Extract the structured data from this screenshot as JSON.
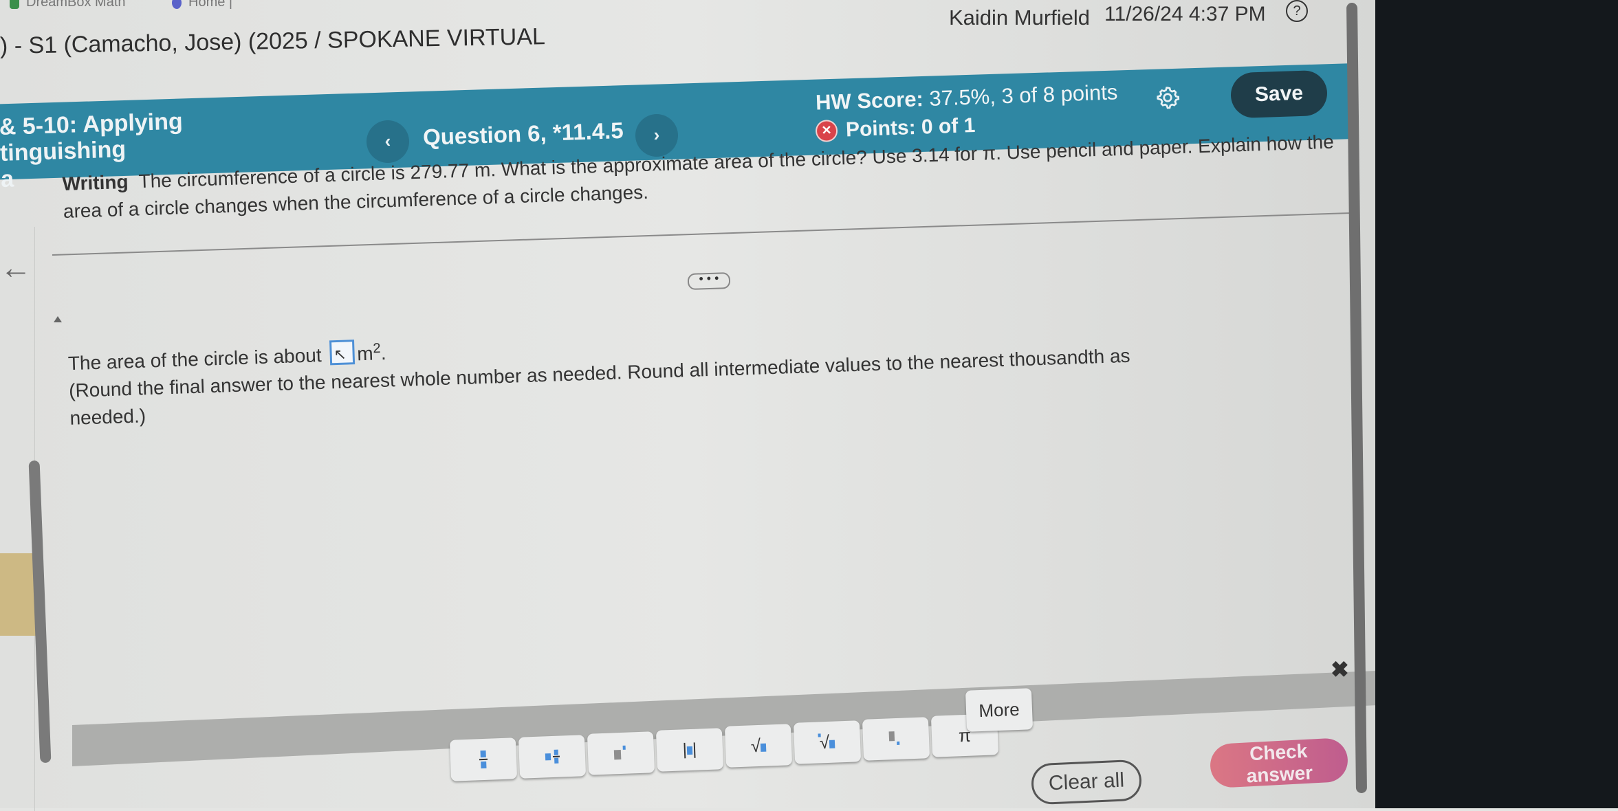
{
  "browser": {
    "bookmarks": [
      {
        "label": "DreamBox Math",
        "icon": "dreambox-icon",
        "color": "#3a8f4a"
      },
      {
        "label": "Home |",
        "icon": "home-bookmark-icon",
        "color": "#5a62c9"
      }
    ]
  },
  "header": {
    "course_title": ") - S1 (Camacho, Jose) (2025 / SPOKANE VIRTUAL",
    "user_name": "Kaidin Murfield",
    "datetime": "11/26/24 4:37 PM",
    "help_icon": "?"
  },
  "assignment_bar": {
    "accent_color": "#2f87a3",
    "breadcrumb_lines": [
      "& 5-10: Applying",
      "tinguishing",
      "a"
    ],
    "prev_label": "‹",
    "next_label": "›",
    "question_label": "Question 6, *11.4.5",
    "hw_score_label": "HW Score:",
    "hw_score_value": "37.5%, 3 of 8 points",
    "points_label": "Points: 0 of 1",
    "points_status": "incorrect",
    "save_label": "Save"
  },
  "question": {
    "tag": "Writing",
    "text": "The circumference of a circle is 279.77 m. What is the approximate area of the circle? Use 3.14 for π. Use pencil and paper. Explain how the area of a circle changes when the circumference of a circle changes.",
    "more_label": "• • •",
    "answer_prefix": "The area of the circle is about",
    "answer_value": "",
    "answer_unit": "m",
    "answer_unit_exp": "2",
    "answer_suffix": ".",
    "instructions": "(Round the final answer to the nearest whole number as needed.  Round all intermediate values to the nearest thousandth as needed.)"
  },
  "math_palette": {
    "buttons": [
      {
        "name": "fraction",
        "label": ""
      },
      {
        "name": "mixed-number",
        "label": ""
      },
      {
        "name": "exponent",
        "label": ""
      },
      {
        "name": "absolute-value",
        "label": "|▮|"
      },
      {
        "name": "square-root",
        "label": "√"
      },
      {
        "name": "nth-root",
        "label": "√"
      },
      {
        "name": "subscript",
        "label": ""
      },
      {
        "name": "pi",
        "label": "π"
      },
      {
        "name": "more",
        "label": "More"
      }
    ],
    "close_label": "✖"
  },
  "footer": {
    "clear_all_label": "Clear all",
    "check_answer_label": "Check answer",
    "check_answer_color": "#cf6a8a"
  }
}
